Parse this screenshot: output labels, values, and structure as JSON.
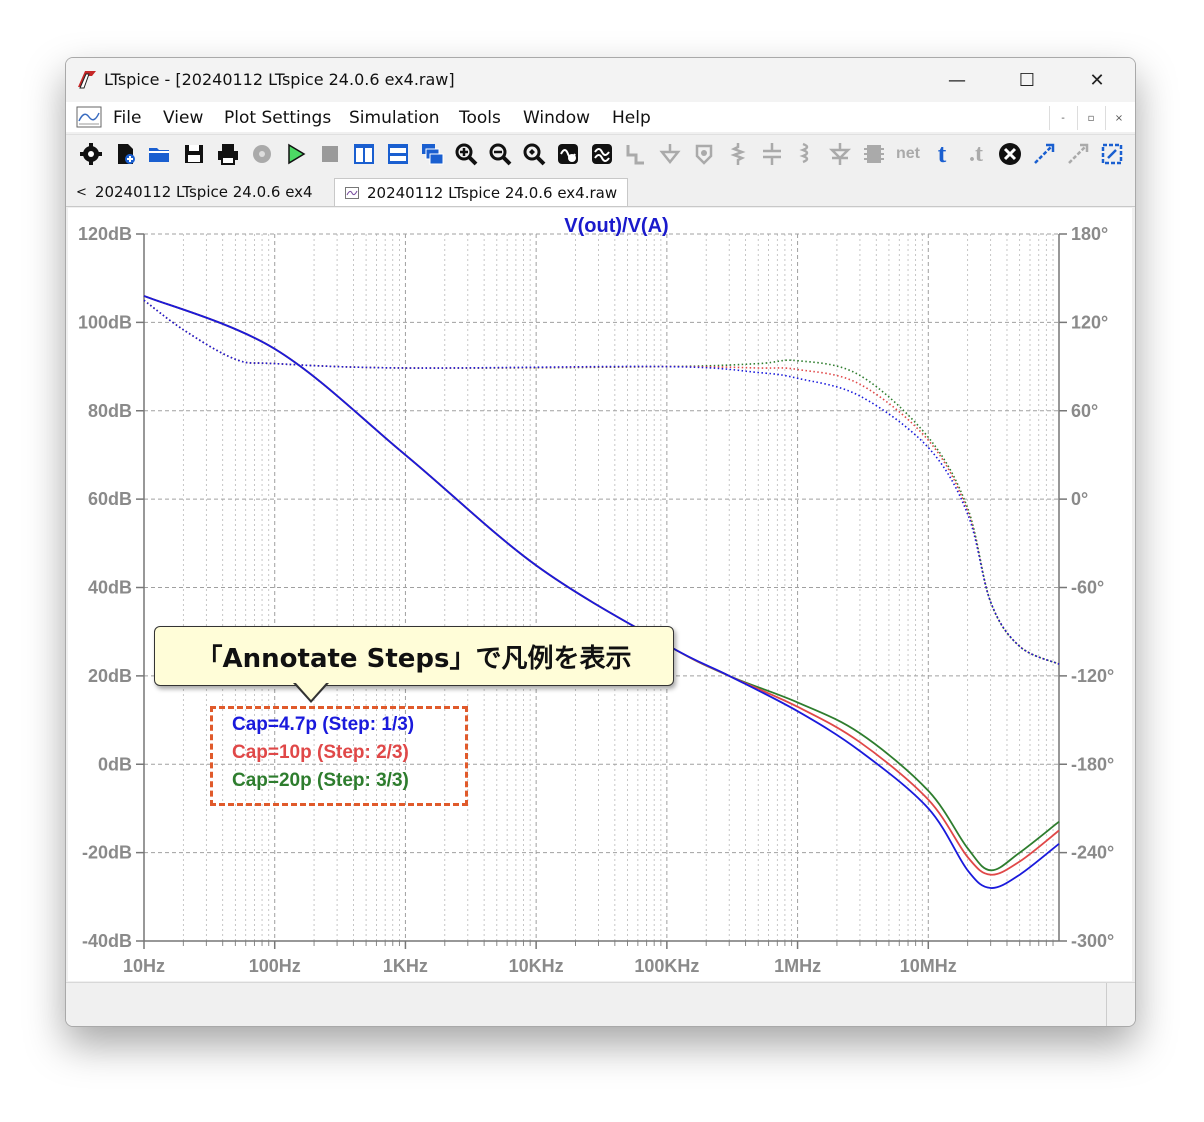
{
  "window": {
    "title": "LTspice - [20240112 LTspice 24.0.6 ex4.raw]",
    "minimize": "—",
    "maximize": "☐",
    "close": "✕"
  },
  "menu": {
    "items": [
      "File",
      "View",
      "Plot Settings",
      "Simulation",
      "Tools",
      "Window",
      "Help"
    ],
    "mdi_buttons": [
      "-",
      "▫",
      "×"
    ]
  },
  "toolbar": {
    "icons": [
      "settings-gear-icon",
      "new-schematic-icon",
      "open-folder-icon",
      "save-disk-icon",
      "print-icon",
      "halt-gear-icon",
      "run-play-icon",
      "stop-square-icon",
      "tile-vertical-icon",
      "tile-horizontal-icon",
      "cascade-windows-icon",
      "zoom-in-icon",
      "zoom-out-icon",
      "zoom-fit-icon",
      "autorange-icon",
      "wave-icon",
      "wire-icon",
      "ground-icon",
      "label-node-icon",
      "resistor-icon",
      "capacitor-icon",
      "inductor-icon",
      "diode-icon",
      "component-icon",
      "net-icon",
      "text-t-icon",
      "spice-directive-icon",
      "delete-x-icon",
      "move-icon",
      "drag-icon",
      "mirror-icon"
    ],
    "net_label": "net",
    "t_label": "t",
    "dot_t_label": ".t"
  },
  "tabs": [
    {
      "label": "20240112 LTspice 24.0.6 ex4",
      "icon": "schematic-back-icon"
    },
    {
      "label": "20240112 LTspice 24.0.6 ex4.raw",
      "icon": "waveform-icon"
    }
  ],
  "callout": {
    "text": "「Annotate Steps」で凡例を表示"
  },
  "legend": [
    {
      "text": "Cap=4.7p  (Step: 1/3)",
      "color": "#1a1adc"
    },
    {
      "text": "Cap=10p  (Step: 2/3)",
      "color": "#e04848"
    },
    {
      "text": "Cap=20p  (Step: 3/3)",
      "color": "#2e7d2e"
    }
  ],
  "chart_data": {
    "type": "line",
    "title": "V(out)/V(A)",
    "title_color": "#1a1acc",
    "x_scale": "log",
    "xlim": [
      10,
      100000000
    ],
    "x_ticks": [
      "10Hz",
      "100Hz",
      "1KHz",
      "10KHz",
      "100KHz",
      "1MHz",
      "10MHz"
    ],
    "y_left_ticks": [
      "120dB",
      "100dB",
      "80dB",
      "60dB",
      "40dB",
      "20dB",
      "0dB",
      "-20dB",
      "-40dB"
    ],
    "ylim": [
      -40,
      120
    ],
    "y_right_ticks": [
      "180°",
      "120°",
      "60°",
      "0°",
      "-60°",
      "-120°",
      "-180°",
      "-240°",
      "-300°"
    ],
    "y2lim": [
      -300,
      180
    ],
    "grid": true,
    "series": [
      {
        "name": "Cap=4.7p",
        "color": "#1a1adc",
        "magnitude": [
          [
            10,
            106
          ],
          [
            100,
            94
          ],
          [
            1000,
            70
          ],
          [
            10000,
            45
          ],
          [
            100000,
            27
          ],
          [
            300000,
            20
          ],
          [
            1000000,
            12
          ],
          [
            3000000,
            3
          ],
          [
            10000000,
            -10
          ],
          [
            20000000,
            -24
          ],
          [
            30000000,
            -28
          ],
          [
            50000000,
            -25
          ],
          [
            100000000,
            -18
          ]
        ],
        "phase": [
          [
            10,
            135
          ],
          [
            20,
            115
          ],
          [
            50,
            95
          ],
          [
            100,
            92
          ],
          [
            1000,
            89
          ],
          [
            100000,
            90
          ],
          [
            500000,
            86
          ],
          [
            1000000,
            82
          ],
          [
            3000000,
            70
          ],
          [
            10000000,
            35
          ],
          [
            20000000,
            -10
          ],
          [
            30000000,
            -70
          ],
          [
            50000000,
            -100
          ],
          [
            100000000,
            -112
          ]
        ]
      },
      {
        "name": "Cap=10p",
        "color": "#e04848",
        "magnitude": [
          [
            10,
            106
          ],
          [
            100,
            94
          ],
          [
            1000,
            70
          ],
          [
            10000,
            45
          ],
          [
            100000,
            27
          ],
          [
            300000,
            20
          ],
          [
            1000000,
            13
          ],
          [
            3000000,
            5
          ],
          [
            10000000,
            -8
          ],
          [
            20000000,
            -21
          ],
          [
            30000000,
            -25
          ],
          [
            50000000,
            -22
          ],
          [
            100000000,
            -15
          ]
        ],
        "phase": [
          [
            10,
            135
          ],
          [
            20,
            115
          ],
          [
            50,
            95
          ],
          [
            100,
            92
          ],
          [
            1000,
            89
          ],
          [
            100000,
            90
          ],
          [
            500000,
            89
          ],
          [
            1000000,
            88
          ],
          [
            3000000,
            78
          ],
          [
            10000000,
            40
          ],
          [
            20000000,
            -8
          ],
          [
            30000000,
            -70
          ],
          [
            50000000,
            -100
          ],
          [
            100000000,
            -112
          ]
        ]
      },
      {
        "name": "Cap=20p",
        "color": "#2e7d2e",
        "magnitude": [
          [
            10,
            106
          ],
          [
            100,
            94
          ],
          [
            1000,
            70
          ],
          [
            10000,
            45
          ],
          [
            100000,
            27
          ],
          [
            300000,
            20
          ],
          [
            1000000,
            14
          ],
          [
            3000000,
            7
          ],
          [
            10000000,
            -6
          ],
          [
            20000000,
            -19
          ],
          [
            30000000,
            -24
          ],
          [
            50000000,
            -20
          ],
          [
            100000000,
            -13
          ]
        ],
        "phase": [
          [
            10,
            135
          ],
          [
            20,
            115
          ],
          [
            50,
            95
          ],
          [
            100,
            92
          ],
          [
            1000,
            89
          ],
          [
            100000,
            90
          ],
          [
            500000,
            92
          ],
          [
            1000000,
            94
          ],
          [
            3000000,
            84
          ],
          [
            10000000,
            42
          ],
          [
            20000000,
            -6
          ],
          [
            30000000,
            -70
          ],
          [
            50000000,
            -100
          ],
          [
            100000000,
            -112
          ]
        ]
      }
    ]
  }
}
